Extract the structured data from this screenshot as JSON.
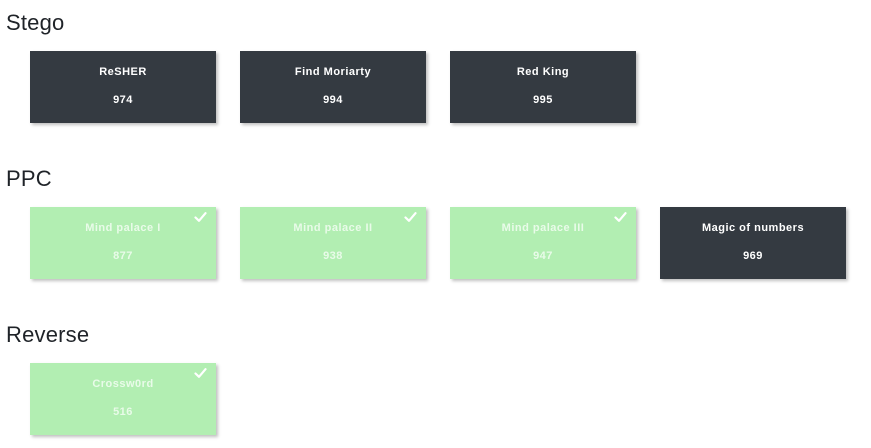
{
  "categories": [
    {
      "title": "Stego",
      "tasks": [
        {
          "name": "ReSHER",
          "points": "974",
          "solved": false
        },
        {
          "name": "Find Moriarty",
          "points": "994",
          "solved": false
        },
        {
          "name": "Red King",
          "points": "995",
          "solved": false
        }
      ]
    },
    {
      "title": "PPC",
      "tasks": [
        {
          "name": "Mind palace I",
          "points": "877",
          "solved": true
        },
        {
          "name": "Mind palace II",
          "points": "938",
          "solved": true
        },
        {
          "name": "Mind palace III",
          "points": "947",
          "solved": true
        },
        {
          "name": "Magic of numbers",
          "points": "969",
          "solved": false
        }
      ]
    },
    {
      "title": "Reverse",
      "tasks": [
        {
          "name": "Crossw0rd",
          "points": "516",
          "solved": true
        }
      ]
    }
  ],
  "colors": {
    "unsolved_bg": "#343a41",
    "solved_bg": "#b2eeb2",
    "solved_text": "#e9fbe9",
    "unsolved_text": "#ffffff"
  },
  "icons": {
    "solved_marker": "check-icon"
  }
}
